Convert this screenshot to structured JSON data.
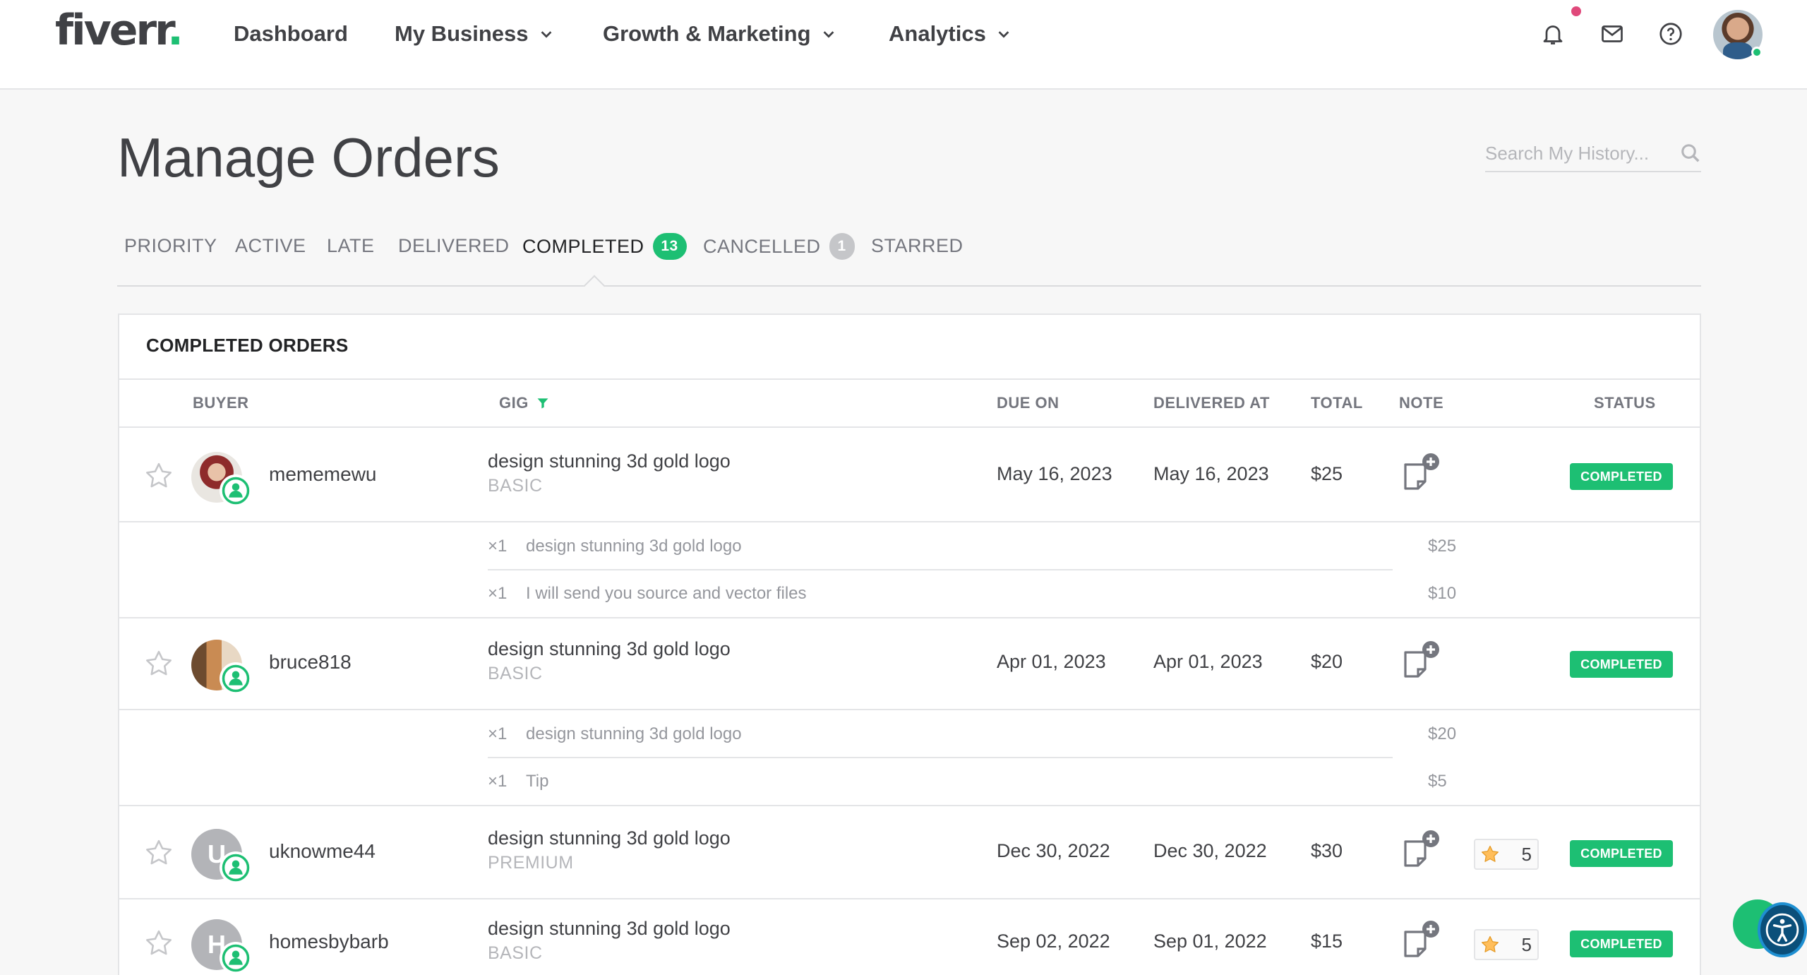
{
  "header": {
    "logo_text": "fiverr",
    "logo_dot": ".",
    "nav": {
      "dashboard": "Dashboard",
      "my_business": "My Business",
      "growth_marketing": "Growth & Marketing",
      "analytics": "Analytics"
    },
    "icons": [
      "bell-icon",
      "mail-icon",
      "help-icon",
      "user-avatar"
    ]
  },
  "page": {
    "title": "Manage Orders",
    "search_placeholder": "Search My History..."
  },
  "tabs": [
    {
      "label": "PRIORITY"
    },
    {
      "label": "ACTIVE"
    },
    {
      "label": "LATE"
    },
    {
      "label": "DELIVERED"
    },
    {
      "label": "COMPLETED",
      "count": "13",
      "active": true
    },
    {
      "label": "CANCELLED",
      "count": "1"
    },
    {
      "label": "STARRED"
    }
  ],
  "orders_card": {
    "title": "COMPLETED ORDERS",
    "columns": {
      "buyer": "BUYER",
      "gig": "GIG",
      "due_on": "DUE ON",
      "delivered_at": "DELIVERED AT",
      "total": "TOTAL",
      "note": "NOTE",
      "status": "STATUS"
    },
    "rows": [
      {
        "buyer": "mememewu",
        "gig_title": "design stunning 3d gold logo",
        "package": "BASIC",
        "due_on": "May 16, 2023",
        "delivered_at": "May 16, 2023",
        "total": "$25",
        "status": "COMPLETED",
        "extras": [
          {
            "qty": "×1",
            "desc": "design stunning 3d gold logo",
            "price": "$25"
          },
          {
            "qty": "×1",
            "desc": "I will send you source and vector files",
            "price": "$10"
          }
        ]
      },
      {
        "buyer": "bruce818",
        "gig_title": "design stunning 3d gold logo",
        "package": "BASIC",
        "due_on": "Apr 01, 2023",
        "delivered_at": "Apr 01, 2023",
        "total": "$20",
        "status": "COMPLETED",
        "extras": [
          {
            "qty": "×1",
            "desc": "design stunning 3d gold logo",
            "price": "$20"
          },
          {
            "qty": "×1",
            "desc": "Tip",
            "price": "$5"
          }
        ]
      },
      {
        "buyer": "uknowme44",
        "initial": "U",
        "gig_title": "design stunning 3d gold logo",
        "package": "PREMIUM",
        "due_on": "Dec 30, 2022",
        "delivered_at": "Dec 30, 2022",
        "total": "$30",
        "rating": "5",
        "status": "COMPLETED"
      },
      {
        "buyer": "homesbybarb",
        "initial": "H",
        "gig_title": "design stunning 3d gold logo",
        "package": "BASIC",
        "due_on": "Sep 02, 2022",
        "delivered_at": "Sep 01, 2022",
        "total": "$15",
        "rating": "5",
        "status": "COMPLETED"
      }
    ]
  },
  "colors": {
    "brand_green": "#1dbf73",
    "text_dark": "#404145",
    "text_muted": "#74767e",
    "notification_dot": "#e0497b"
  }
}
